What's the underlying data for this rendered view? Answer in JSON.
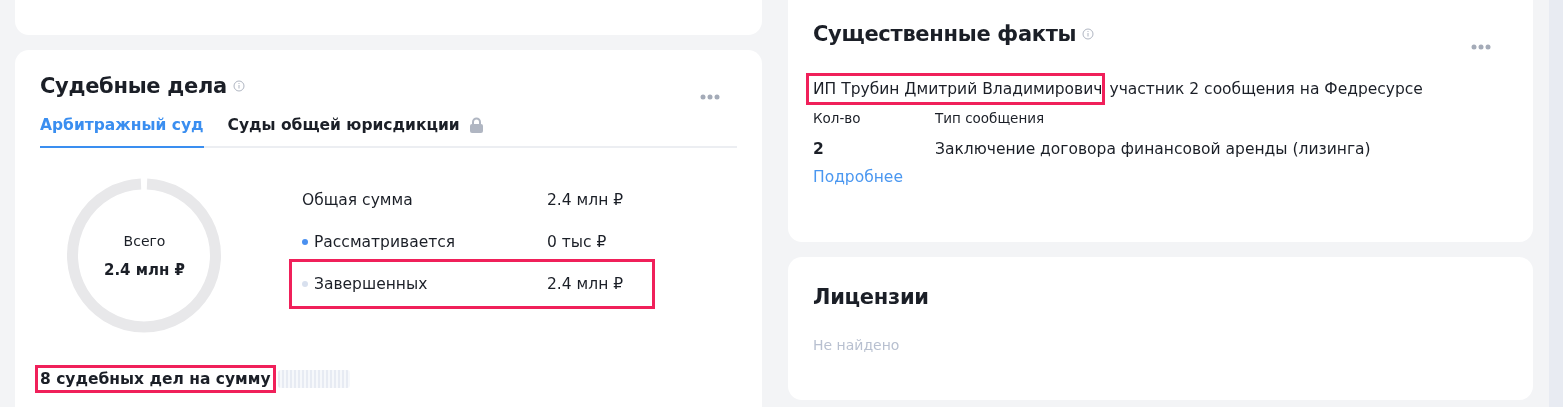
{
  "court_cases": {
    "title": "Судебные дела",
    "tabs": [
      {
        "label": "Арбитражный суд",
        "selected": true,
        "locked": false
      },
      {
        "label": "Суды общей юрисдикции",
        "selected": false,
        "locked": true
      }
    ],
    "total": {
      "label": "Всего",
      "value": "2.4 млн ₽"
    },
    "rows": [
      {
        "label": "Общая сумма",
        "value": "2.4 млн ₽",
        "highlighted": false
      },
      {
        "label": "Рассматривается",
        "value": "0 тыс ₽",
        "color": "#4a90f0",
        "highlighted": false
      },
      {
        "label": "Завершенных",
        "value": "2.4 млн ₽",
        "color": "#d8e0ee",
        "highlighted": true
      }
    ],
    "summary": {
      "text": "8 судебных дел на сумму",
      "highlighted": true
    }
  },
  "facts": {
    "title": "Существенные факты",
    "company": {
      "text": "ИП Трубин Дмитрий Владимирович",
      "highlighted": true
    },
    "sentence": "участник 2 сообщения на Федресурсе",
    "columns": [
      "Кол-во",
      "Тип сообщения"
    ],
    "rows": [
      [
        "2",
        "Заключение договора финансовой аренды (лизинга)"
      ]
    ],
    "link": "Подробнее"
  },
  "licenses": {
    "title": "Лицензии",
    "empty": "Не найдено"
  }
}
